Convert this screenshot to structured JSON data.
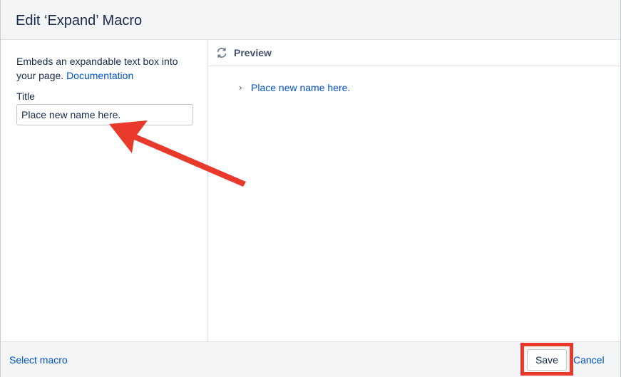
{
  "dialog": {
    "title": "Edit ‘Expand’ Macro"
  },
  "left_panel": {
    "description": "Embeds an expandable text box into your page.",
    "documentation_link": "Documentation",
    "title_label": "Title",
    "title_value": "Place new name here."
  },
  "preview": {
    "icon": "refresh-icon",
    "label": "Preview",
    "chevron": "›",
    "expand_title": "Place new name here."
  },
  "footer": {
    "select_macro": "Select macro",
    "save": "Save",
    "cancel": "Cancel"
  },
  "colors": {
    "link": "#0052cc",
    "annotation": "#e8392b",
    "header_bg": "#f4f5f7"
  }
}
